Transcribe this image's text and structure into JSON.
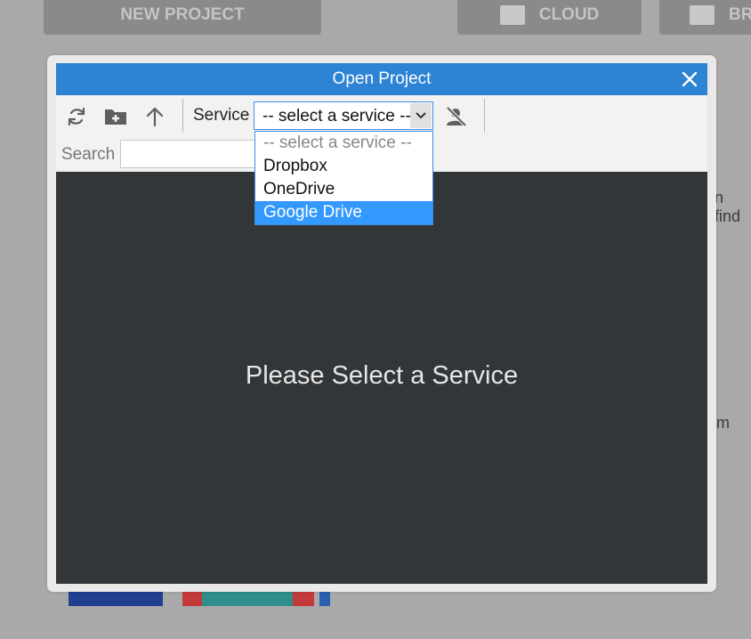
{
  "background": {
    "buttons": [
      {
        "label": "NEW PROJECT"
      },
      {
        "label": "CLOUD"
      },
      {
        "label": "BR"
      }
    ],
    "text_fragments": [
      "n find",
      "m"
    ]
  },
  "dialog": {
    "title": "Open Project",
    "toolbar": {
      "service_label": "Service",
      "service_value": "-- select a service --",
      "search_label": "Search",
      "search_value": ""
    },
    "empty_message": "Please Select a Service",
    "dropdown": {
      "options": [
        {
          "label": "-- select a service --",
          "placeholder": true
        },
        {
          "label": "Dropbox"
        },
        {
          "label": "OneDrive"
        },
        {
          "label": "Google Drive",
          "highlighted": true
        }
      ]
    }
  },
  "colors": {
    "titlebar": "#2d83d4",
    "content_bg": "#333639",
    "highlight": "#3399ff"
  },
  "icons": [
    "refresh-icon",
    "new-folder-icon",
    "arrow-up-icon",
    "chevron-down-icon",
    "user-off-icon",
    "close-icon"
  ]
}
